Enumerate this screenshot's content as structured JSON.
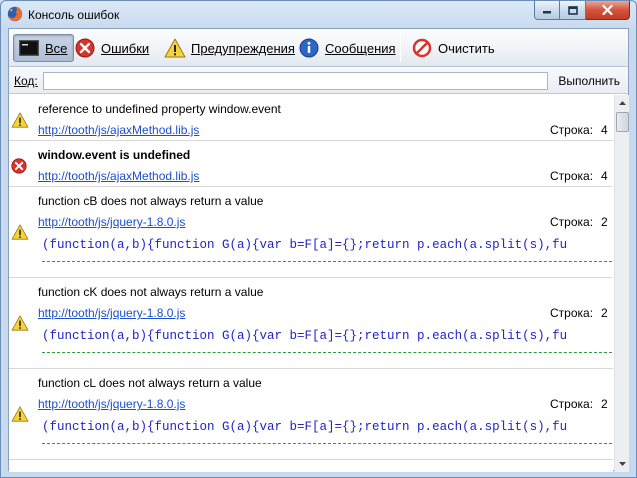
{
  "window": {
    "title": "Консоль ошибок",
    "close_color": "#c13c25"
  },
  "toolbar": {
    "all_label": "Все",
    "errors_label": "Ошибки",
    "warnings_label": "Предупреждения",
    "messages_label": "Сообщения",
    "clear_label": "Очистить"
  },
  "code_bar": {
    "label": "Код:",
    "input_value": "",
    "run_label": "Выполнить"
  },
  "line_label": "Строка:",
  "entries": [
    {
      "type": "warning",
      "message": "reference to undefined property window.event",
      "source": "http://tooth/js/ajaxMethod.lib.js",
      "line": "4",
      "code": ""
    },
    {
      "type": "error",
      "message": "window.event is undefined",
      "source": "http://tooth/js/ajaxMethod.lib.js",
      "line": "4",
      "code": ""
    },
    {
      "type": "warning",
      "message": "function cB does not always return a value",
      "source": "http://tooth/js/jquery-1.8.0.js",
      "line": "2",
      "code": "(function(a,b){function G(a){var b=F[a]={};return p.each(a.split(s),fu"
    },
    {
      "type": "warning",
      "message": "function cK does not always return a value",
      "source": "http://tooth/js/jquery-1.8.0.js",
      "line": "2",
      "code": "(function(a,b){function G(a){var b=F[a]={};return p.each(a.split(s),fu"
    },
    {
      "type": "warning",
      "message": "function cL does not always return a value",
      "source": "http://tooth/js/jquery-1.8.0.js",
      "line": "2",
      "code": "(function(a,b){function G(a){var b=F[a]={};return p.each(a.split(s),fu"
    }
  ]
}
